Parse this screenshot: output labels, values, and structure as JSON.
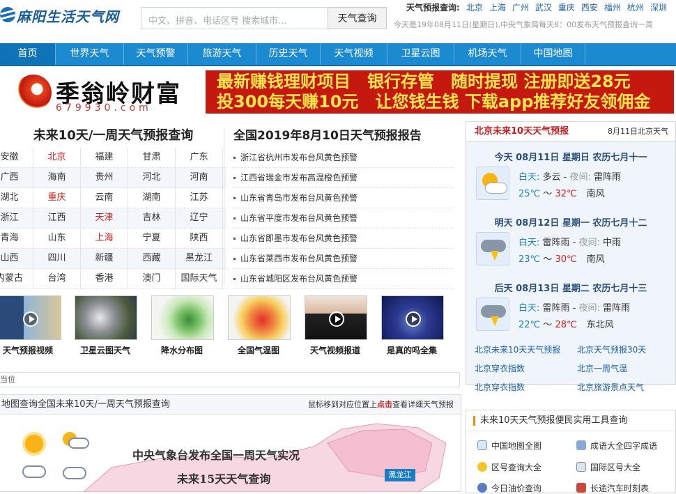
{
  "header": {
    "logo_text": "麻阳生活天气网",
    "search_placeholder": "中文、拼音、电话区号 搜索城市...",
    "search_button": "天气查询",
    "quick_label": "天气预报查询:",
    "quick_cities": [
      "北京",
      "上海",
      "广州",
      "武汉",
      "重庆",
      "西安",
      "福州",
      "杭州",
      "深圳"
    ],
    "notice": "今天是19年08月11日(星期日),中央气象局每天8：00发布天气预报查询一周"
  },
  "nav": [
    "首页",
    "世界天气",
    "天气预警",
    "旅游天气",
    "历史天气",
    "天气视频",
    "卫星云图",
    "机场天气",
    "中国地图"
  ],
  "banner": {
    "brand": "季翁岭财富",
    "number": "679930.com",
    "line1": "最新赚钱理财项目　银行存管　随时提现 注册即送28元",
    "line2": "投300每天赚10元　让您钱生钱 下载app推荐好友领佣金"
  },
  "left": {
    "title": "未来10天/一周天气预报查询",
    "rows": [
      [
        "安徽",
        "北京",
        "福建",
        "甘肃",
        "广东"
      ],
      [
        "广西",
        "海南",
        "贵州",
        "河北",
        "河南"
      ],
      [
        "湖北",
        "重庆",
        "云南",
        "湖南",
        "江苏"
      ],
      [
        "浙江",
        "江西",
        "天津",
        "吉林",
        "辽宁"
      ],
      [
        "青海",
        "山东",
        "上海",
        "宁夏",
        "陕西"
      ],
      [
        "山西",
        "四川",
        "新疆",
        "西藏",
        "黑龙江"
      ],
      [
        "内蒙古",
        "台湾",
        "香港",
        "澳门",
        "国际天气"
      ]
    ]
  },
  "alerts": {
    "title": "全国2019年8月10日天气预报报告",
    "items": [
      "浙江省杭州市发布台风黄色预警",
      "江西省瑞金市发布高温橙色预警",
      "山东省青岛市发布台风黄色预警",
      "山东省平度市发布台风黄色预警",
      "山东省即墨市发布台风黄色预警",
      "山东省莱西市发布台风黄色预警",
      "山东省城阳区发布台风黄色预警"
    ]
  },
  "thumbs": [
    "天气预报视频",
    "卫星云图天气",
    "降水分布图",
    "全国气温图",
    "天气视频报道",
    "是真的吗全集"
  ],
  "position_label": "当位",
  "map": {
    "title": "地图查询全国未来10天/一周天气预报查询",
    "hint_pre": "鼠标移到对应位置上",
    "hint_red": "点击",
    "hint_post": "查看详细天气预报",
    "text1": "中央气象台发布全国一周天气实况",
    "text2": "未来15天天气查询",
    "region": "黑龙江"
  },
  "forecast": {
    "title": "北京未来10天天气预报",
    "date": "8月11日北京天气",
    "days": [
      {
        "date": "今天 08月11日 星期日 农历七月十一",
        "day_label": "白天:",
        "day_weather": "多云",
        "night_label": "夜间:",
        "night_weather": "雷阵雨",
        "low": "25℃",
        "sep": "～",
        "high": "32℃",
        "wind": "南风",
        "icon": "partly-cloudy-icon"
      },
      {
        "date": "明天 08月12日 星期一 农历七月十二",
        "day_label": "白天:",
        "day_weather": "雷阵雨",
        "night_label": "夜间:",
        "night_weather": "中雨",
        "low": "23℃",
        "sep": "～",
        "high": "30℃",
        "wind": "南风",
        "icon": "thunderstorm-icon"
      },
      {
        "date": "后天 08月13日 星期二 农历七月十三",
        "day_label": "白天:",
        "day_weather": "雷阵雨",
        "night_label": "夜间:",
        "night_weather": "雷阵雨",
        "low": "22℃",
        "sep": "～",
        "high": "28℃",
        "wind": "东北风",
        "icon": "thunderstorm-icon"
      }
    ],
    "links": [
      "北京未来10天天气预报",
      "北京天气预报30天",
      "北京穿衣指数",
      "北京一周气温",
      "北京穿衣指数",
      "北京旅游景点天气"
    ]
  },
  "tools": {
    "title": "未来10天天气预报便民实用工具查询",
    "items": [
      "中国地图全图",
      "成语大全四字成语",
      "区号查询大全",
      "国际区号大全",
      "今日油价查询",
      "长途汽车时刻表"
    ]
  }
}
